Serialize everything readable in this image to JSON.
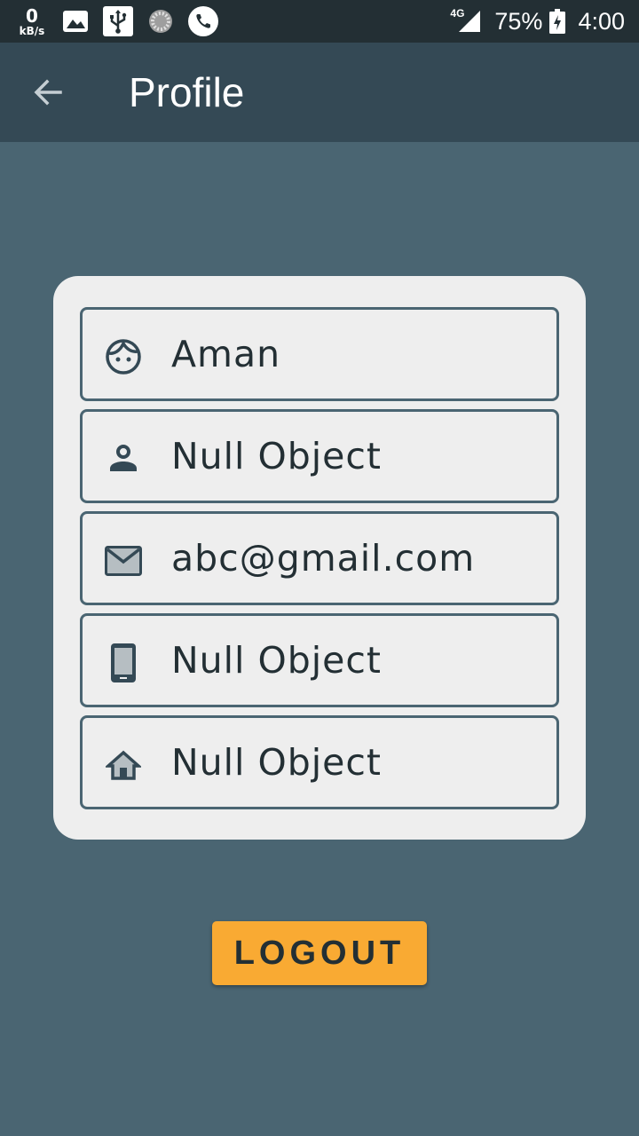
{
  "status_bar": {
    "net_speed": "0",
    "net_unit": "kB/s",
    "network_type": "4G",
    "battery": "75%",
    "time": "4:00",
    "icons": [
      "image-icon",
      "usb-icon",
      "loading-icon",
      "phone-icon",
      "signal-icon",
      "battery-charging-icon"
    ]
  },
  "app_bar": {
    "back_icon": "arrow-back-icon",
    "title": "Profile"
  },
  "profile": {
    "fields": [
      {
        "icon": "face-icon",
        "value": "Aman"
      },
      {
        "icon": "person-icon",
        "value": "Null Object"
      },
      {
        "icon": "email-icon",
        "value": "abc@gmail.com"
      },
      {
        "icon": "phone-android-icon",
        "value": "Null Object"
      },
      {
        "icon": "home-icon",
        "value": "Null Object"
      }
    ]
  },
  "logout_label": "LOGOUT",
  "colors": {
    "status_bar": "#232f34",
    "app_bar": "#344955",
    "background": "#4a6572",
    "card": "#eeeeee",
    "text": "#232f34",
    "accent": "#f9aa33"
  }
}
